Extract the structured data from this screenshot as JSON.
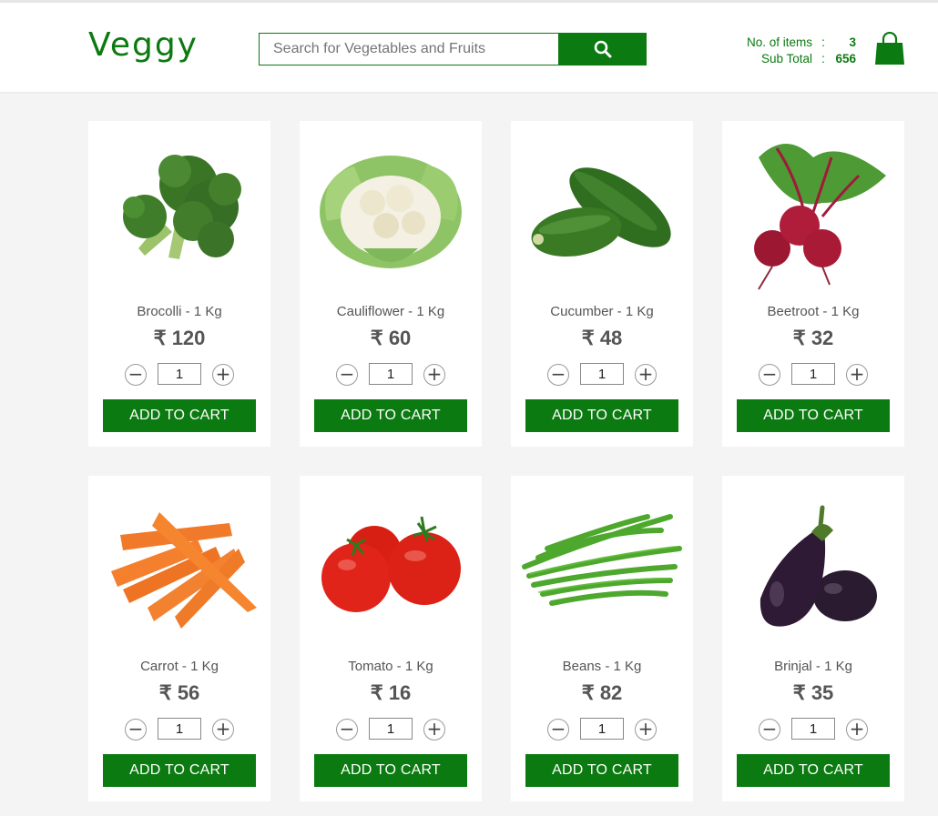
{
  "header": {
    "logo": "Veggy",
    "search": {
      "placeholder": "Search for Vegetables and Fruits",
      "value": ""
    },
    "cart": {
      "items_label": "No. of items",
      "items_count": "3",
      "subtotal_label": "Sub Total",
      "subtotal_value": "656",
      "separator": ":"
    }
  },
  "products": [
    {
      "name": "Brocolli - 1 Kg",
      "price": "₹ 120",
      "qty": "1",
      "button": "ADD TO CART",
      "icon": "broccoli-icon"
    },
    {
      "name": "Cauliflower - 1 Kg",
      "price": "₹ 60",
      "qty": "1",
      "button": "ADD TO CART",
      "icon": "cauliflower-icon"
    },
    {
      "name": "Cucumber - 1 Kg",
      "price": "₹ 48",
      "qty": "1",
      "button": "ADD TO CART",
      "icon": "cucumber-icon"
    },
    {
      "name": "Beetroot - 1 Kg",
      "price": "₹ 32",
      "qty": "1",
      "button": "ADD TO CART",
      "icon": "beetroot-icon"
    },
    {
      "name": "Carrot - 1 Kg",
      "price": "₹ 56",
      "qty": "1",
      "button": "ADD TO CART",
      "icon": "carrot-icon"
    },
    {
      "name": "Tomato - 1 Kg",
      "price": "₹ 16",
      "qty": "1",
      "button": "ADD TO CART",
      "icon": "tomato-icon"
    },
    {
      "name": "Beans - 1 Kg",
      "price": "₹ 82",
      "qty": "1",
      "button": "ADD TO CART",
      "icon": "beans-icon"
    },
    {
      "name": "Brinjal - 1 Kg",
      "price": "₹ 35",
      "qty": "1",
      "button": "ADD TO CART",
      "icon": "brinjal-icon"
    }
  ],
  "stepper": {
    "minus": "−",
    "plus": "+"
  },
  "colors": {
    "brand": "#0b7a10",
    "background": "#f4f4f4"
  }
}
